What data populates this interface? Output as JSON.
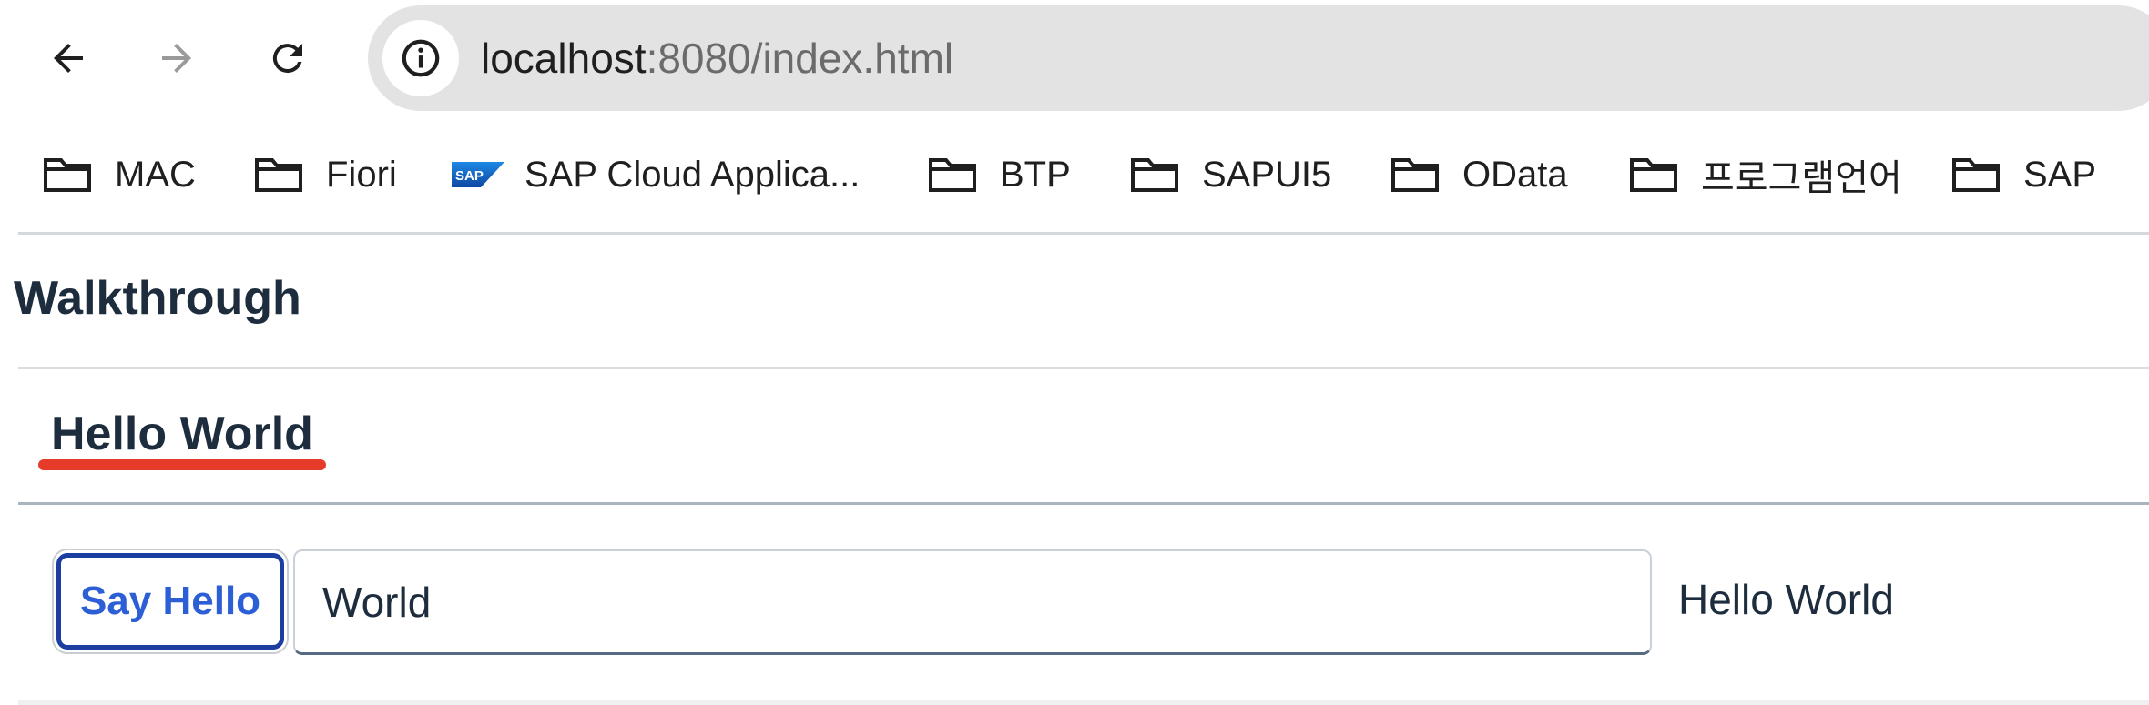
{
  "browser": {
    "url_host": "localhost",
    "url_path": ":8080/index.html",
    "icons": {
      "back": "arrow-left-icon",
      "forward": "arrow-right-icon",
      "reload": "reload-icon",
      "site_info": "info-icon"
    }
  },
  "bookmarks": [
    {
      "label": "MAC",
      "icon": "folder-icon"
    },
    {
      "label": "Fiori",
      "icon": "folder-icon"
    },
    {
      "label": "SAP Cloud Applica...",
      "icon": "sap-logo-icon"
    },
    {
      "label": "BTP",
      "icon": "folder-icon"
    },
    {
      "label": "SAPUI5",
      "icon": "folder-icon"
    },
    {
      "label": "OData",
      "icon": "folder-icon"
    },
    {
      "label": "프로그램언어",
      "icon": "folder-icon"
    },
    {
      "label": "SAP",
      "icon": "folder-icon"
    }
  ],
  "app": {
    "title": "Walkthrough",
    "panel_title": "Hello World",
    "button_label": "Say Hello",
    "input_value": "World",
    "greeting_text": "Hello World"
  },
  "colors": {
    "accent_blue": "#2c5ed6",
    "button_border": "#1b3ea0",
    "annotation_red": "#e63a2a",
    "heading_text": "#1d2d3e",
    "omnibox_bg": "#e3e3e3"
  }
}
